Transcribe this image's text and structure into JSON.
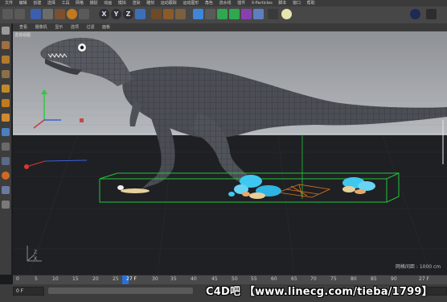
{
  "menu": [
    "文件",
    "编辑",
    "创建",
    "选择",
    "工具",
    "网格",
    "捕捉",
    "动画",
    "模拟",
    "渲染",
    "雕刻",
    "运动跟踪",
    "运动图形",
    "角色",
    "流水线",
    "插件",
    "X-Particles",
    "脚本",
    "窗口",
    "帮助"
  ],
  "toolbar": {
    "axis_x": "X",
    "axis_y": "Y",
    "axis_z": "Z"
  },
  "viewport": {
    "tabs": [
      "查看",
      "摄像机",
      "显示",
      "选项",
      "过滤",
      "面板"
    ],
    "title": "透视视图",
    "grid_spacing": "网格间距 : 1000 cm",
    "axis_x": "X",
    "axis_z": "Z"
  },
  "timeline": {
    "ticks": [
      "0",
      "5",
      "10",
      "15",
      "20",
      "25",
      "30",
      "35",
      "40",
      "45",
      "50",
      "55",
      "60",
      "65",
      "70",
      "75",
      "80",
      "85",
      "90"
    ],
    "current_frame": "27 F",
    "end_frame": "27 F"
  },
  "bottom": {
    "start_field": "0 F",
    "watermark": "C4D吧 【www.linecg.com/tieba/1799】"
  },
  "colors": {
    "bounding_box": "#21c53a",
    "particles": "#3ec8f0",
    "emitter": "#e0781e",
    "horizon": "#c9ccd0"
  }
}
